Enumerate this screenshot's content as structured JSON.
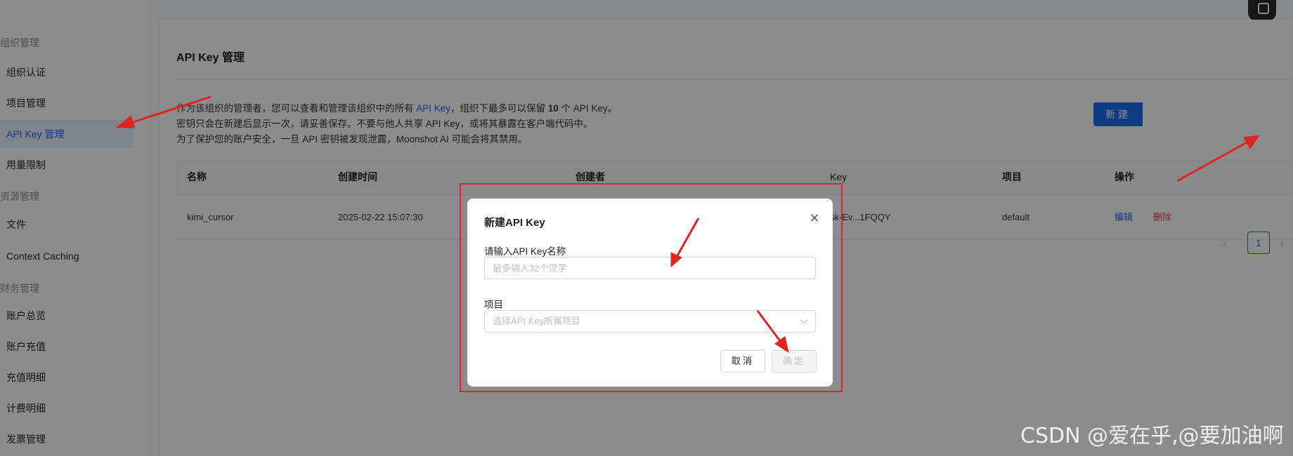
{
  "sidebar": {
    "groups": [
      "组织管理",
      "资源管理",
      "财务管理"
    ],
    "items": [
      {
        "label": "组织认证"
      },
      {
        "label": "项目管理"
      },
      {
        "label": "API Key 管理"
      },
      {
        "label": "用量限制"
      },
      {
        "label": "文件"
      },
      {
        "label": "Context Caching"
      },
      {
        "label": "账户总览"
      },
      {
        "label": "账户充值"
      },
      {
        "label": "充值明细"
      },
      {
        "label": "计费明细"
      },
      {
        "label": "发票管理"
      }
    ]
  },
  "main": {
    "title": "API Key 管理",
    "notice": {
      "line1_a": "作为该组织的管理者，您可以查看和管理该组织中的所有 ",
      "line1_b": "API Key",
      "line1_c": "，组织下最多可以保留 ",
      "line1_count": "10",
      "line1_d": " 个 API Key。",
      "line2": "密钥只会在新建后显示一次，请妥善保存。不要与他人共享 API Key，或将其暴露在客户端代码中。",
      "line3": "为了保护您的账户安全，一旦 API 密钥被发现泄露，Moonshot AI 可能会将其禁用。"
    },
    "new_button": "新建",
    "table": {
      "headers": [
        "名称",
        "创建时间",
        "创建者",
        "Key",
        "项目",
        "操作"
      ],
      "rows": [
        {
          "name": "kimi_cursor",
          "created_at": "2025-02-22 15:07:30",
          "key": "sk-Ev...1FQQY",
          "project": "default",
          "edit": "编辑",
          "delete": "删除"
        }
      ]
    },
    "pagination": {
      "prev": "‹",
      "current": "1",
      "next": "›"
    }
  },
  "modal": {
    "title": "新建API Key",
    "close": "×",
    "name_label": "请输入API Key名称",
    "name_placeholder": "最多输入32个汉字",
    "project_label": "项目",
    "project_placeholder": "选择API Key所属项目",
    "cancel": "取消",
    "confirm": "确定"
  },
  "watermark": "CSDN @爱在乎,@要加油啊",
  "colors": {
    "accent": "#1a6cf0",
    "danger": "#e5484d",
    "annotation": "#e02424"
  }
}
